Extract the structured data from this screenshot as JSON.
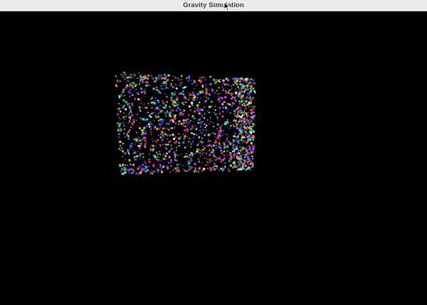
{
  "window": {
    "title": "Gravity Simulation"
  },
  "simulation": {
    "background_color": "#000000",
    "particle_palette": [
      "#ff3b3b",
      "#3bff6b",
      "#3b8bff",
      "#ff3bf0",
      "#3bf6ff",
      "#ffe23b",
      "#b03bff",
      "#ff8f3b",
      "#ffffff",
      "#6bff3b",
      "#3b4bff",
      "#ff3b9b"
    ],
    "particle_count": 1800
  },
  "icons": {
    "cursor": "mouse-pointer-icon"
  }
}
